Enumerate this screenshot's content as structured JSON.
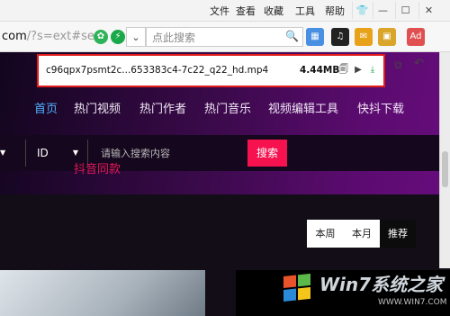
{
  "menubar": {
    "items": [
      "文件",
      "查看",
      "收藏",
      "工具",
      "帮助"
    ],
    "window_buttons": [
      "👕",
      "—",
      "☐",
      "✕"
    ]
  },
  "toolbar": {
    "url_main": "com",
    "url_rest": "/?s=ext#seai",
    "search_placeholder": "点此搜索",
    "dropdown_glyph": "⌄",
    "search_glyph": "🔍"
  },
  "download": {
    "filename": "c96qpx7psmt2c...653383c4-7c22_q22_hd.mp4",
    "size": "4.44MB"
  },
  "site": {
    "nav": [
      "首页",
      "热门视频",
      "热门作者",
      "热门音乐",
      "视频编辑工具",
      "快抖下载"
    ],
    "search_type": "ID",
    "search_placeholder": "请输入搜索内容",
    "search_button": "搜索",
    "tiktok_label": "抖音同款",
    "tabs": [
      "本周",
      "本月",
      "推荐"
    ]
  },
  "watermark": {
    "text": "Win7系统之家",
    "sub": "WWW.WIN7.COM"
  },
  "colors": {
    "accent_red": "#e21b1b",
    "nav_active": "#4fb2ff",
    "search_button": "#f5124f",
    "tiktok_label": "#e6175e"
  }
}
